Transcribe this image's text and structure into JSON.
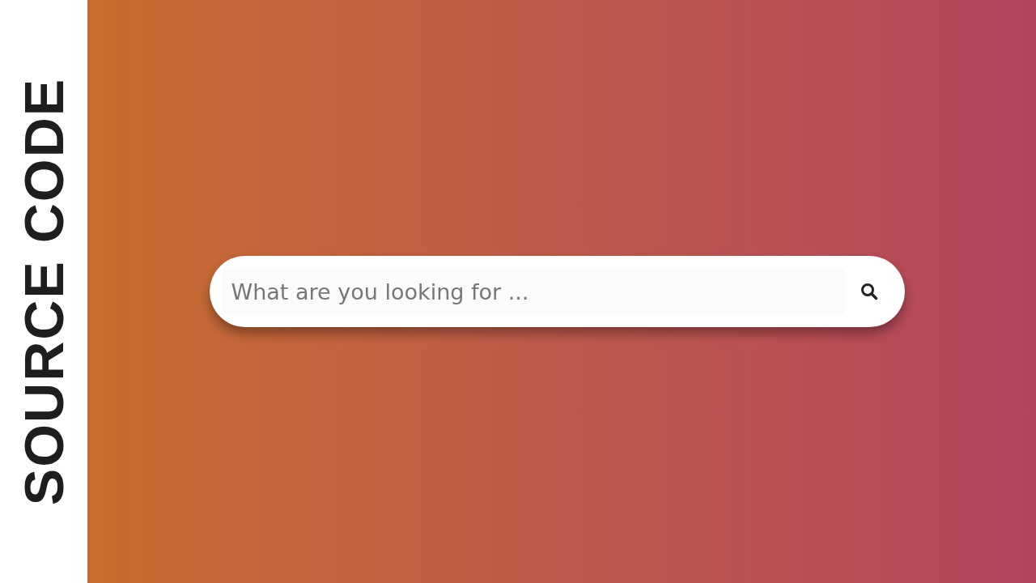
{
  "side_label": "SOURCE CODE",
  "search": {
    "placeholder": "What are you looking for ..."
  }
}
